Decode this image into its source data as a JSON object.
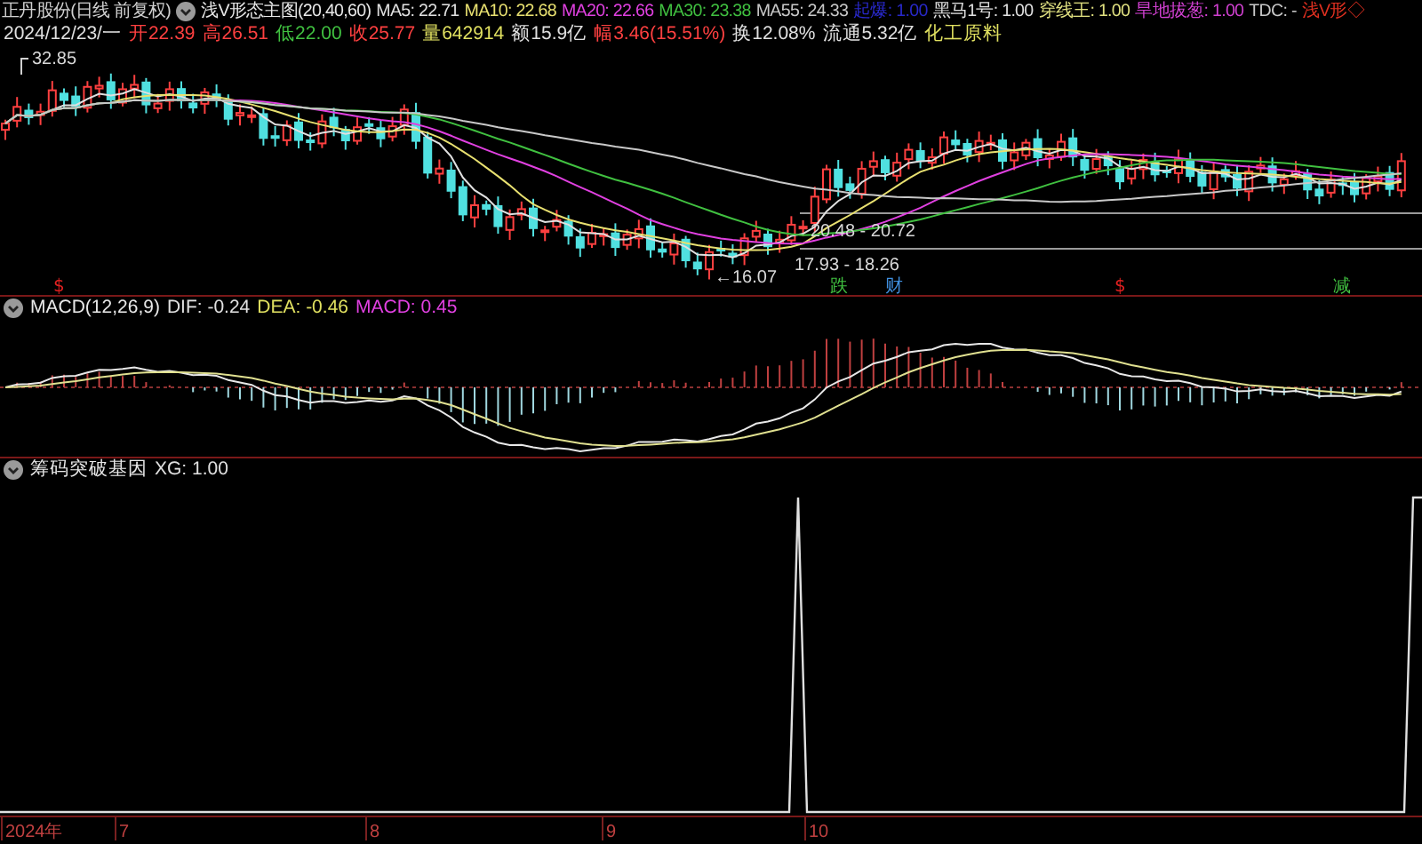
{
  "header": {
    "stock": "正丹股份(日线 前复权)",
    "indicator": "浅V形态主图(20,40,60)",
    "values": [
      {
        "text": "MA5: 22.71",
        "color": "#e0e0e0"
      },
      {
        "text": "MA10: 22.68",
        "color": "#e8e070"
      },
      {
        "text": "MA20: 22.66",
        "color": "#e040e0"
      },
      {
        "text": "MA30: 23.38",
        "color": "#40c040"
      },
      {
        "text": "MA55: 24.33",
        "color": "#c8c8c8"
      },
      {
        "text": "起爆: 1.00",
        "color": "#2828c8"
      },
      {
        "text": "黑马1号: 1.00",
        "color": "#e0e0e0"
      },
      {
        "text": "穿线王: 1.00",
        "color": "#e0e080"
      },
      {
        "text": "旱地拔葱: 1.00",
        "color": "#d040d0"
      },
      {
        "text": "TDC: -",
        "color": "#c8c8c8"
      },
      {
        "text": "浅V形◇",
        "color": "#e03020"
      }
    ]
  },
  "quote": [
    {
      "text": "2024/12/23/一",
      "color": "#e0e0e0"
    },
    {
      "text": "开22.39",
      "color": "#ff4040"
    },
    {
      "text": "高26.51",
      "color": "#ff4040"
    },
    {
      "text": "低22.00",
      "color": "#40c040"
    },
    {
      "text": "收25.77",
      "color": "#ff4040"
    },
    {
      "text": "量642914",
      "color": "#e0e060"
    },
    {
      "text": "额15.9亿",
      "color": "#e0e0e0"
    },
    {
      "text": "幅3.46(15.51%)",
      "color": "#ff4040"
    },
    {
      "text": "换12.08%",
      "color": "#e0e0e0"
    },
    {
      "text": "流通5.32亿",
      "color": "#e0e0e0"
    },
    {
      "text": "化工原料",
      "color": "#e0e060"
    }
  ],
  "main_chart": {
    "high_label": "32.85",
    "low_label": "←16.07",
    "zones": [
      "20.48 - 20.72",
      "17.93 - 18.26"
    ],
    "markers": [
      {
        "text": "$",
        "color": "#e02020"
      },
      {
        "text": "跌",
        "color": "#40c040"
      },
      {
        "text": "财",
        "color": "#4090e0"
      },
      {
        "text": "$",
        "color": "#e02020"
      },
      {
        "text": "减",
        "color": "#40c040"
      }
    ]
  },
  "macd": {
    "title": "MACD(12,26,9)",
    "values": [
      {
        "text": "DIF: -0.24",
        "color": "#e0e0e0"
      },
      {
        "text": "DEA: -0.46",
        "color": "#e0e060"
      },
      {
        "text": "MACD: 0.45",
        "color": "#e040e0"
      }
    ]
  },
  "xg": {
    "title": "筹码突破基因",
    "value": "XG: 1.00"
  },
  "time_axis": [
    "2024年",
    "7",
    "8",
    "9",
    "10"
  ]
}
